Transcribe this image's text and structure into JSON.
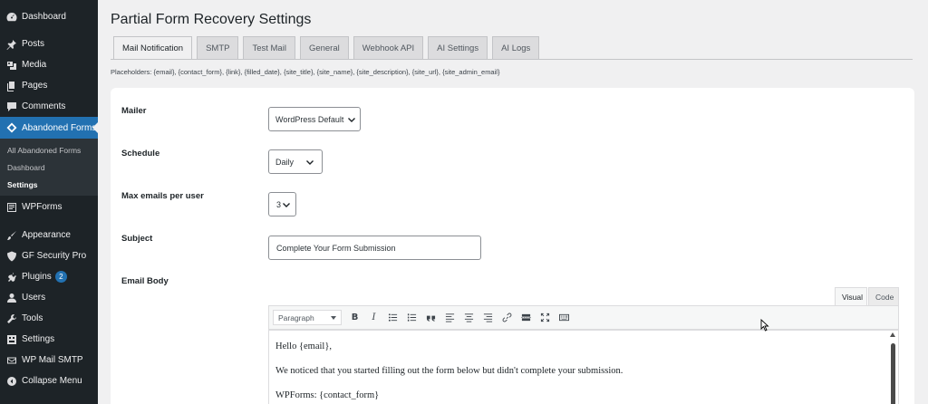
{
  "sidebar": {
    "items": [
      {
        "label": "Dashboard",
        "icon": "dashboard-icon"
      },
      {
        "label": "Posts",
        "icon": "pin-icon"
      },
      {
        "label": "Media",
        "icon": "media-icon"
      },
      {
        "label": "Pages",
        "icon": "pages-icon"
      },
      {
        "label": "Comments",
        "icon": "comment-icon"
      },
      {
        "label": "Abandoned Forms",
        "icon": "forms-tag-icon"
      },
      {
        "label": "WPForms",
        "icon": "wpforms-icon"
      },
      {
        "label": "Appearance",
        "icon": "brush-icon"
      },
      {
        "label": "GF Security Pro",
        "icon": "shield-icon"
      },
      {
        "label": "Plugins",
        "icon": "plugin-icon",
        "badge": "2"
      },
      {
        "label": "Users",
        "icon": "user-icon"
      },
      {
        "label": "Tools",
        "icon": "wrench-icon"
      },
      {
        "label": "Settings",
        "icon": "settings-icon"
      },
      {
        "label": "WP Mail SMTP",
        "icon": "mail-icon"
      },
      {
        "label": "Collapse Menu",
        "icon": "collapse-icon"
      }
    ],
    "submenu": [
      "All Abandoned Forms",
      "Dashboard",
      "Settings"
    ]
  },
  "page": {
    "title": "Partial Form Recovery Settings",
    "tabs": [
      "Mail Notification",
      "SMTP",
      "Test Mail",
      "General",
      "Webhook API",
      "AI Settings",
      "AI Logs"
    ],
    "active_tab": "Mail Notification",
    "placeholders": "Placeholders: {email}, {contact_form}, {link}, {filled_date}, {site_title}, {site_name}, {site_description}, {site_url}, {site_admin_email}"
  },
  "form": {
    "mailer_label": "Mailer",
    "mailer_value": "WordPress Default",
    "schedule_label": "Schedule",
    "schedule_value": "Daily",
    "max_label": "Max emails per user",
    "max_value": "3",
    "subject_label": "Subject",
    "subject_value": "Complete Your Form Submission",
    "body_label": "Email Body"
  },
  "editor": {
    "visual_tab": "Visual",
    "code_tab": "Code",
    "format": "Paragraph",
    "bold": "B",
    "italic": "I",
    "lines": [
      "Hello {email},",
      "We noticed that you started filling out the form below but didn't complete your submission.",
      "WPForms: {contact_form}"
    ]
  },
  "colors": {
    "sidebar_bg": "#1d2327",
    "accent": "#2271b1",
    "page_bg": "#f0f0f1"
  }
}
